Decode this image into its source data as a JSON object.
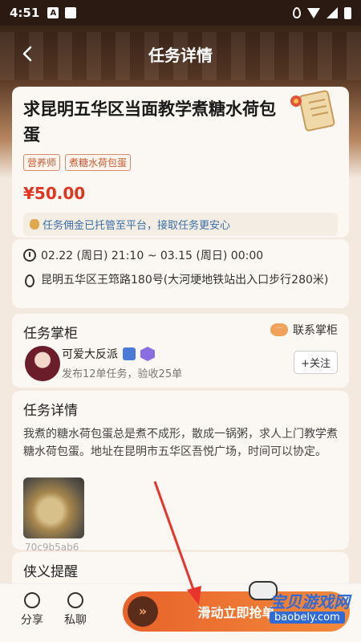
{
  "status_bar": {
    "time": "4:51",
    "a_icon": "A"
  },
  "header": {
    "title": "任务详情"
  },
  "task": {
    "title": "求昆明五华区当面教学煮糖水荷包蛋",
    "tags": [
      "营养师",
      "煮糖水荷包蛋"
    ],
    "price": "¥50.00",
    "notice": "任务佣金已托管至平台，接取任务更安心"
  },
  "schedule": {
    "time_range": "02.22 (周日) 21:10 ~ 03.15 (周日) 00:00",
    "address": "昆明五华区王筇路180号(大河埂地铁站出入口步行280米)"
  },
  "owner": {
    "section_title": "任务掌柜",
    "contact_label": "联系掌柜",
    "contact_icon_text": "···",
    "name": "可爱大反派",
    "stats": "发布12单任务，验收25单",
    "follow_label": "+关注"
  },
  "detail": {
    "section_title": "任务详情",
    "text": "我煮的糖水荷包蛋总是煮不成形，散成一锅粥，求人上门教学煮糖水荷包蛋。地址在昆明市五华区吾悦广场，时间可以协定。",
    "image_caption": "70c9b5ab6"
  },
  "reminder": {
    "section_title": "侠义提醒"
  },
  "bottom_bar": {
    "share_label": "分享",
    "chat_label": "私聊",
    "grab_label": "滑动立即抢单",
    "grab_knob": "»"
  },
  "watermark": {
    "text": "宝贝游戏网",
    "url": "baobely.com"
  },
  "colors": {
    "accent": "#e8622a",
    "price": "#e2341f",
    "notice_text": "#3a6ea8",
    "header_dark": "#3a2418"
  },
  "icons": [
    "back-arrow-icon",
    "clock-icon",
    "location-pin-icon",
    "chat-bubble-icon",
    "share-icon",
    "message-icon",
    "double-chevron-right-icon",
    "scroll-icon"
  ]
}
